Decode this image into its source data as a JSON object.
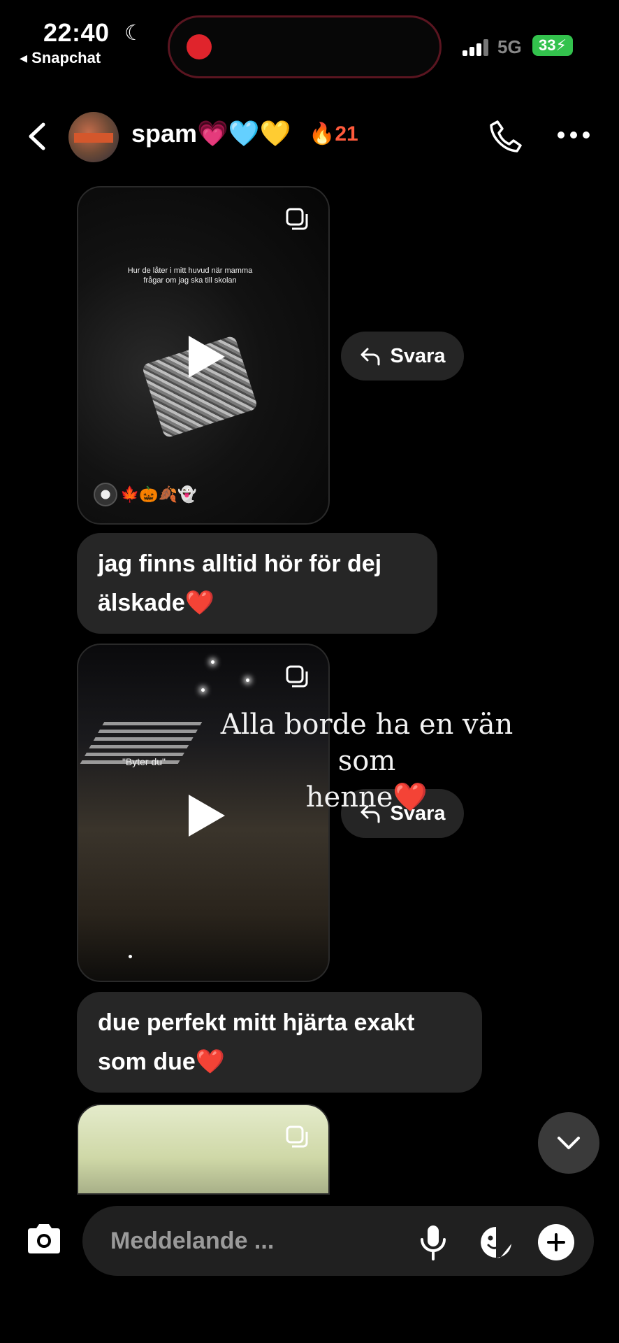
{
  "status_bar": {
    "time": "22:40",
    "back_app": "◂ Snapchat",
    "network": "5G",
    "battery": "33"
  },
  "header": {
    "title": "spam💗🩵💛",
    "streak": "🔥21"
  },
  "messages": [
    {
      "type": "video",
      "overlay_text": "Hur de låter i mitt huvud när mamma frågar om jag ska till skolan",
      "reactions": "🍁🎃🍂👻",
      "reply_label": "Svara"
    },
    {
      "type": "text",
      "text_line1": "jag finns alltid hör för dej",
      "text_line2": "älskade❤️"
    },
    {
      "type": "video",
      "overlay_text": "\"Byter du\"",
      "reply_label": "Svara"
    },
    {
      "type": "text",
      "text_line1": "due perfekt mitt hjärta exakt",
      "text_line2": "som due❤️"
    }
  ],
  "caption": {
    "line1": "Alla borde ha en vän som",
    "line2": "henne❤️"
  },
  "composer": {
    "placeholder": "Meddelande ..."
  },
  "colors": {
    "background": "#000000",
    "bubble": "#262626",
    "streak": "#ff5a3c",
    "battery": "#33c24d",
    "recording": "#e0242c"
  }
}
